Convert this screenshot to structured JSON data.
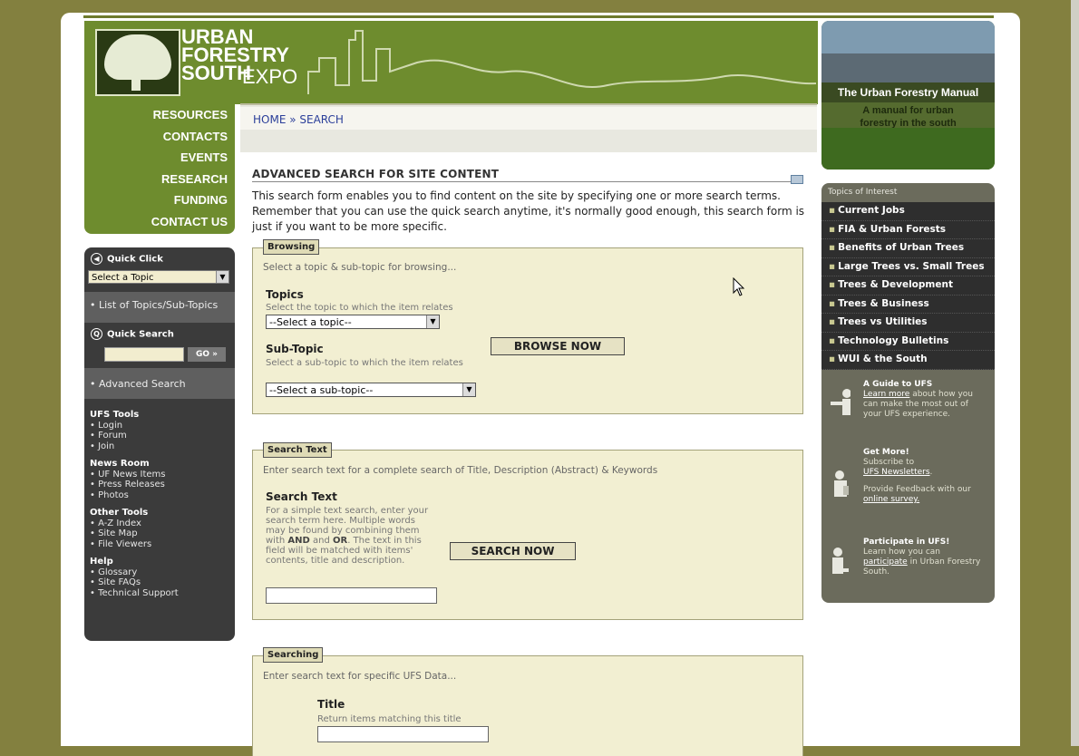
{
  "logo": {
    "line1": "URBAN",
    "line2": "FORESTRY",
    "line3": "SOUTH",
    "expo": "EXPO"
  },
  "nav": [
    "RESOURCES",
    "CONTACTS",
    "EVENTS",
    "RESEARCH",
    "FUNDING",
    "CONTACT US"
  ],
  "quick_click": {
    "title": "Quick Click",
    "select_value": "Select a Topic",
    "list_link": "List of Topics/Sub-Topics"
  },
  "quick_search": {
    "title": "Quick Search",
    "go_label": "GO »",
    "advanced_link": "Advanced Search"
  },
  "tools": [
    {
      "heading": "UFS Tools",
      "items": [
        "Login",
        "Forum",
        "Join"
      ]
    },
    {
      "heading": "News Room",
      "items": [
        "UF News Items",
        "Press Releases",
        "Photos"
      ]
    },
    {
      "heading": "Other Tools",
      "items": [
        "A-Z Index",
        "Site Map",
        "File Viewers"
      ]
    },
    {
      "heading": "Help",
      "items": [
        "Glossary",
        "Site FAQs",
        "Technical Support"
      ]
    }
  ],
  "breadcrumb": "HOME » SEARCH",
  "page": {
    "title": "ADVANCED SEARCH FOR SITE CONTENT",
    "intro": "This search form enables you to find content on the site by specifying one or more search terms. Remember that you can use the quick search anytime, it's normally good enough, this search form is just if you want to be more specific."
  },
  "browsing": {
    "legend": "Browsing",
    "desc": "Select a topic & sub-topic for browsing...",
    "topics_label": "Topics",
    "topics_help": "Select the topic to which the item relates",
    "topics_value": "--Select a topic--",
    "subtopic_label": "Sub-Topic",
    "subtopic_help": "Select a sub-topic to which the item relates",
    "subtopic_value": "--Select a sub-topic--",
    "button": "BROWSE NOW"
  },
  "search_text": {
    "legend": "Search Text",
    "desc": "Enter search text for a complete search of Title, Description (Abstract) & Keywords",
    "label": "Search Text",
    "help_1": "For a simple text search, enter your search term here. Multiple words may be found by combining them with ",
    "and": "AND",
    "help_2": " and ",
    "or": "OR",
    "help_3": ". The text in this field will be matched with items' contents, title and description.",
    "button": "SEARCH NOW",
    "value": ""
  },
  "searching": {
    "legend": "Searching",
    "desc": "Enter search text for specific UFS Data...",
    "title_label": "Title",
    "title_help": "Return items matching this title",
    "title_value": ""
  },
  "manual": {
    "title": "The Urban Forestry Manual",
    "sub1": "A manual for urban",
    "sub2": "forestry in the south"
  },
  "interest": {
    "title": "Topics of Interest",
    "items": [
      "Current Jobs",
      "FIA & Urban Forests",
      "Benefits of Urban Trees",
      "Large Trees vs. Small Trees",
      "Trees & Development",
      "Trees & Business",
      "Trees vs Utilities",
      "Technology Bulletins",
      "WUI & the South"
    ]
  },
  "promos": {
    "guide": {
      "title": "A Guide to UFS",
      "link": "Learn more",
      "text": " about how you can make the most out of your UFS experience."
    },
    "getmore": {
      "title": "Get More!",
      "text1": "Subscribe to",
      "link1": "UFS Newsletters",
      "text2": ".",
      "text3": "Provide Feedback with our",
      "link2": "online survey."
    },
    "participate": {
      "title": "Participate in UFS!",
      "text1": "Learn how you can",
      "link": "participate",
      "text2": " in Urban Forestry South."
    }
  },
  "colors": {
    "olive_bg": "#83803f",
    "green": "#6e8c2e",
    "dark": "#3b3b3b",
    "panel": "#f2efd2",
    "link": "#2b3f9a"
  }
}
